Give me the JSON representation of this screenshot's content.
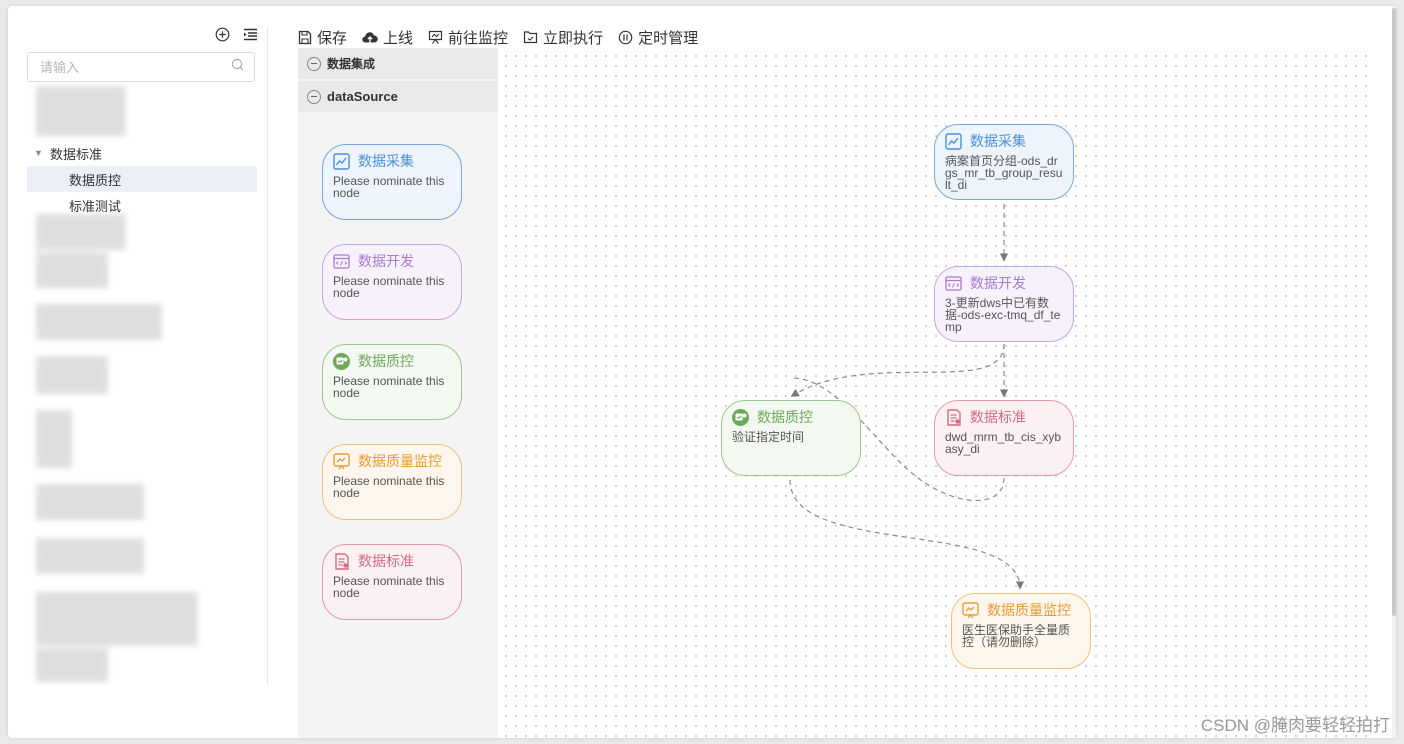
{
  "tree": {
    "search_placeholder": "请输入",
    "parent_label": "数据标准",
    "children": [
      "数据质控",
      "标准测试"
    ]
  },
  "toolbar": {
    "save": "保存",
    "publish": "上线",
    "monitor": "前往监控",
    "execute": "立即执行",
    "schedule": "定时管理"
  },
  "palette": {
    "groups": [
      "数据集成",
      "dataSource"
    ],
    "nodes": [
      {
        "title": "数据采集",
        "text": "Please nominate this node"
      },
      {
        "title": "数据开发",
        "text": "Please nominate this node"
      },
      {
        "title": "数据质控",
        "text": "Please nominate this node"
      },
      {
        "title": "数据质量监控",
        "text": "Please nominate this node"
      },
      {
        "title": "数据标准",
        "text": "Please nominate this node"
      }
    ]
  },
  "canvas": {
    "nodes": [
      {
        "title": "数据采集",
        "text": "病案首页分组-ods_drgs_mr_tb_group_result_di"
      },
      {
        "title": "数据开发",
        "text": "3-更新dws中已有数据-ods-exc-tmq_df_temp"
      },
      {
        "title": "数据质控",
        "text": "验证指定时间"
      },
      {
        "title": "数据标准",
        "text": "dwd_mrm_tb_cis_xybasy_di"
      },
      {
        "title": "数据质量监控",
        "text": "医生医保助手全量质控（请勿删除）"
      }
    ]
  },
  "colors": {
    "collect": "#4a8fdc",
    "develop": "#a77bd0",
    "quality": "#6ea95a",
    "monitor": "#eb9a34",
    "standard": "#d26b82"
  },
  "watermark": "CSDN @腌肉要轻轻拍打"
}
